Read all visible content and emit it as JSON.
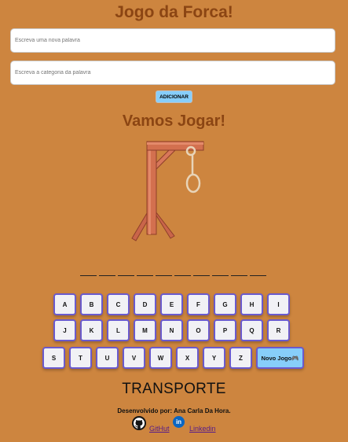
{
  "header": {
    "title": "Jogo da Forca!"
  },
  "form": {
    "word_placeholder": "Escreva uma nova palavra",
    "category_placeholder": "Escreva a categoria da palavra",
    "add_label": "ADICIONAR"
  },
  "game": {
    "subtitle": "Vamos Jogar!",
    "revealed_letters": [
      "",
      "",
      "",
      "",
      "",
      "",
      "",
      "",
      "",
      ""
    ],
    "category": "TRANSPORTE"
  },
  "keyboard": {
    "row1": [
      "A",
      "B",
      "C",
      "D",
      "E",
      "F",
      "G",
      "H",
      "I"
    ],
    "row2": [
      "J",
      "K",
      "L",
      "M",
      "N",
      "O",
      "P",
      "Q",
      "R"
    ],
    "row3": [
      "S",
      "T",
      "U",
      "V",
      "W",
      "X",
      "Y",
      "Z"
    ],
    "new_game_label": "Novo Jogo🎮"
  },
  "footer": {
    "credit": "Desenvolvido por: Ana Carla Da Hora.",
    "github_label": "GitHut",
    "linkedin_label": "Linkedin",
    "linkedin_icon_text": "in"
  },
  "icons": {
    "github": "github-icon",
    "linkedin": "linkedin-icon",
    "gallows": "gallows-illustration"
  },
  "colors": {
    "background": "#cd853f",
    "title": "#8b4513",
    "button": "#87cefa",
    "key_border": "#6a5acd",
    "gallows_wood": "#cf6b4c"
  }
}
